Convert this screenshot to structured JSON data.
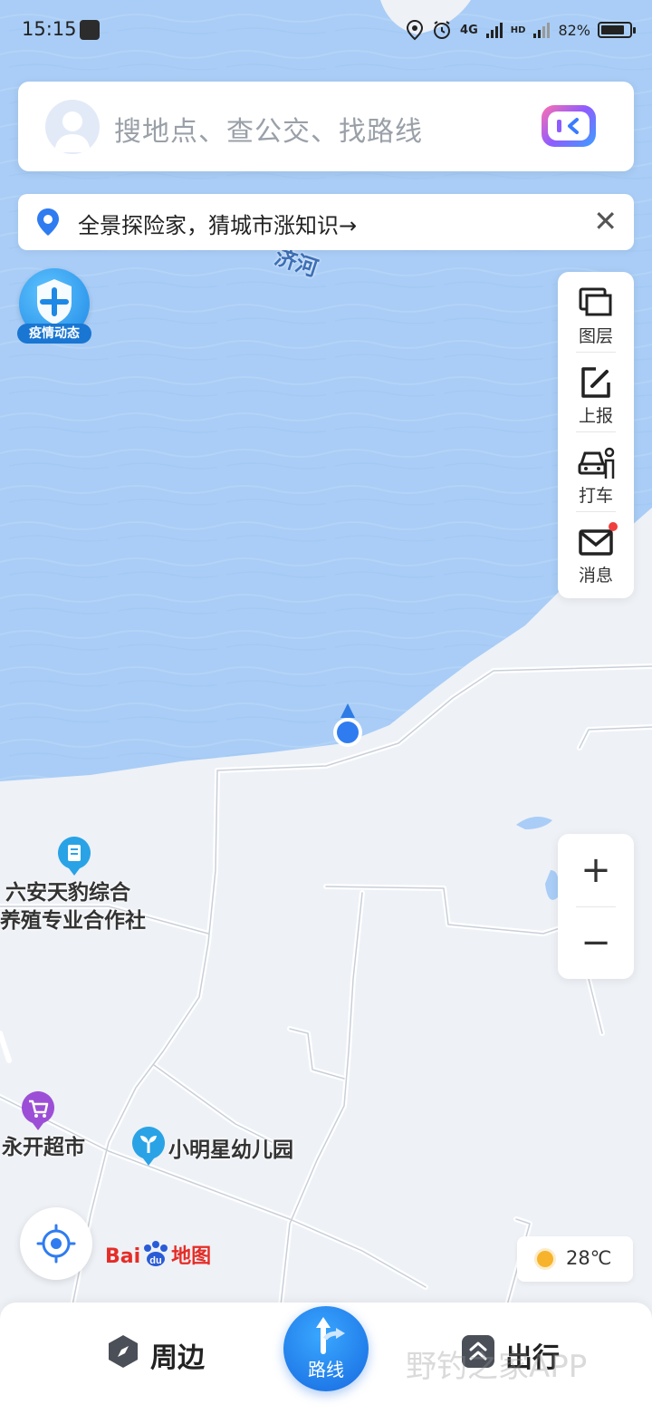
{
  "status_bar": {
    "time": "15:15",
    "network_1": "4G",
    "network_2": "4G",
    "hd": "HD",
    "battery": "82%",
    "battery_level": 0.82
  },
  "search": {
    "placeholder": "搜地点、查公交、找路线"
  },
  "notice": {
    "text": "全景探险家，猜城市涨知识→",
    "close": "✕"
  },
  "map": {
    "river_label": "济河",
    "water_color": "#a9cdf6",
    "land_color": "#eef1f6",
    "pois": [
      {
        "name_line1": "六安天豹综合",
        "name_line2": "养殖专业合作社",
        "icon": "building-icon",
        "color": "#29a3e6"
      },
      {
        "name": "永开超市",
        "icon": "shopping-cart-icon",
        "color": "#9c4fd6"
      },
      {
        "name": "小明星幼儿园",
        "icon": "sprout-icon",
        "color": "#29a3e6"
      }
    ]
  },
  "epidemic_badge": {
    "label": "疫情动态"
  },
  "tools": [
    {
      "label": "图层",
      "icon": "layers-icon"
    },
    {
      "label": "上报",
      "icon": "report-edit-icon"
    },
    {
      "label": "打车",
      "icon": "taxi-icon"
    },
    {
      "label": "消息",
      "icon": "mail-icon",
      "has_unread": true
    }
  ],
  "zoom": {
    "in": "+",
    "out": "−"
  },
  "logo": {
    "bai": "Bai",
    "du": "du",
    "map": "地图"
  },
  "weather": {
    "temp": "28℃"
  },
  "bottom_nav": {
    "nearby": "周边",
    "route": "路线",
    "travel": "出行",
    "watermark": "野钓之家APP"
  }
}
